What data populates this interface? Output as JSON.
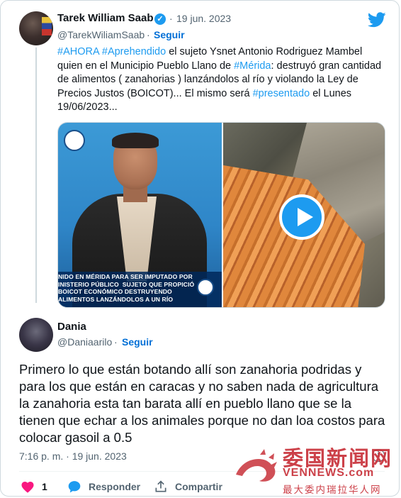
{
  "quoted": {
    "author_name": "Tarek William Saab",
    "separator": "·",
    "date": "19 jun. 2023",
    "handle": "@TarekWiliamSaab",
    "follow_label": "Seguir",
    "text_parts": [
      {
        "type": "tag",
        "text": "#AHORA"
      },
      {
        "type": "text",
        "text": " "
      },
      {
        "type": "tag",
        "text": "#Aprehendido"
      },
      {
        "type": "text",
        "text": "  el sujeto Ysnet Antonio Rodriguez Mambel quien  en el Municipio Pueblo Llano  de "
      },
      {
        "type": "tag",
        "text": "#Mérida"
      },
      {
        "type": "text",
        "text": ":  destruyó gran cantidad de  alimentos ( zanahorias ) lanzándolos al río y violando la Ley de Precios Justos (BOICOT)... El mismo  será "
      },
      {
        "type": "tag",
        "text": "#presentado"
      },
      {
        "type": "text",
        "text": " el Lunes 19/06/2023..."
      }
    ],
    "media_caption": "NIDO EN MÉRIDA PARA SER IMPUTADO POR\nINISTERIO PÚBLICO  SUJETO QUE PROPICIÓ\nBOICOT ECONÓMICO DESTRUYENDO\nALIMENTOS LANZÁNDOLOS A UN RÍO"
  },
  "reply": {
    "author_name": "Dania",
    "handle": "@Daniaarilo",
    "separator": "·",
    "follow_label": "Seguir",
    "text": "Primero lo que están botando allí son zanahoria podridas y para los que están en caracas y no saben nada de agricultura la zanahoria esta tan barata allí en pueblo llano que se la tienen que echar a los animales porque no dan loa costos para colocar gasoil a 0.5",
    "timestamp": "7:16 p. m. · 19 jun. 2023"
  },
  "actions": {
    "like_count": "1",
    "reply_label": "Responder",
    "share_label": "Compartir"
  },
  "watermark": {
    "line1": "委国新闻网",
    "line2": "VENNEWS.com",
    "line3": "最大委内瑞拉华人网"
  },
  "colors": {
    "accent": "#1d9bf0",
    "follow": "#006fd6",
    "like": "#f91880",
    "watermark": "#c8313a"
  },
  "icons": [
    "verified-badge-icon",
    "twitter-bird-icon",
    "play-icon",
    "info-icon",
    "heart-icon",
    "reply-bubble-icon",
    "share-icon",
    "dragon-logo-icon"
  ]
}
